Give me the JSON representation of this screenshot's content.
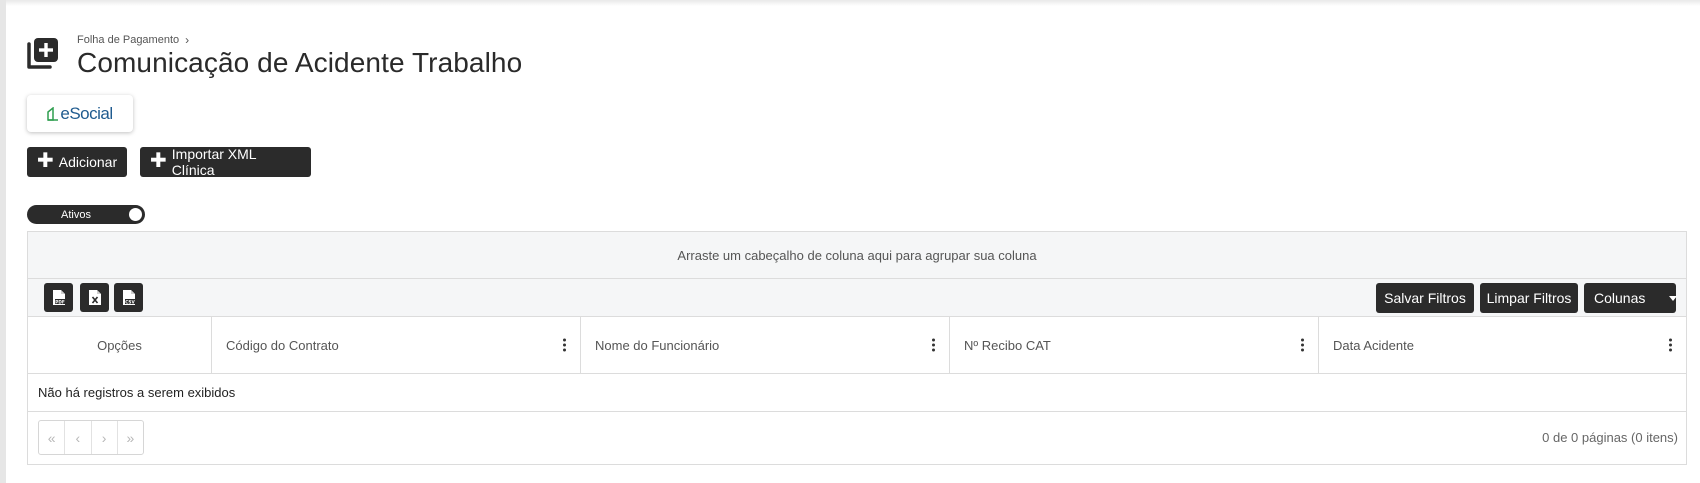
{
  "breadcrumb": {
    "parent": "Folha de Pagamento",
    "separator": "›"
  },
  "page": {
    "title": "Comunicação de Acidente Trabalho"
  },
  "logo": {
    "text": "eSocial"
  },
  "actions": {
    "add_label": "Adicionar",
    "import_label": "Importar XML Clínica"
  },
  "toggle": {
    "label": "Ativos",
    "state": "on"
  },
  "grid": {
    "group_panel_text": "Arraste um cabeçalho de coluna aqui para agrupar sua coluna",
    "toolbar": {
      "export_buttons": [
        "pdf-icon",
        "xls-icon",
        "csv-icon"
      ],
      "save_filters_label": "Salvar Filtros",
      "clear_filters_label": "Limpar Filtros",
      "columns_label": "Colunas"
    },
    "columns": [
      "Opções",
      "Código do Contrato",
      "Nome do Funcionário",
      "Nº Recibo CAT",
      "Data Acidente"
    ],
    "empty_text": "Não há registros a serem exibidos",
    "pager": {
      "first": "«",
      "prev": "‹",
      "next": "›",
      "last": "»",
      "info": "0 de 0 páginas (0 itens)"
    }
  },
  "colors": {
    "primary_dark": "#2b2b2b",
    "panel_bg": "#f5f6f7",
    "logo_blue": "#1f5b8f",
    "logo_green": "#2e9e4f"
  }
}
